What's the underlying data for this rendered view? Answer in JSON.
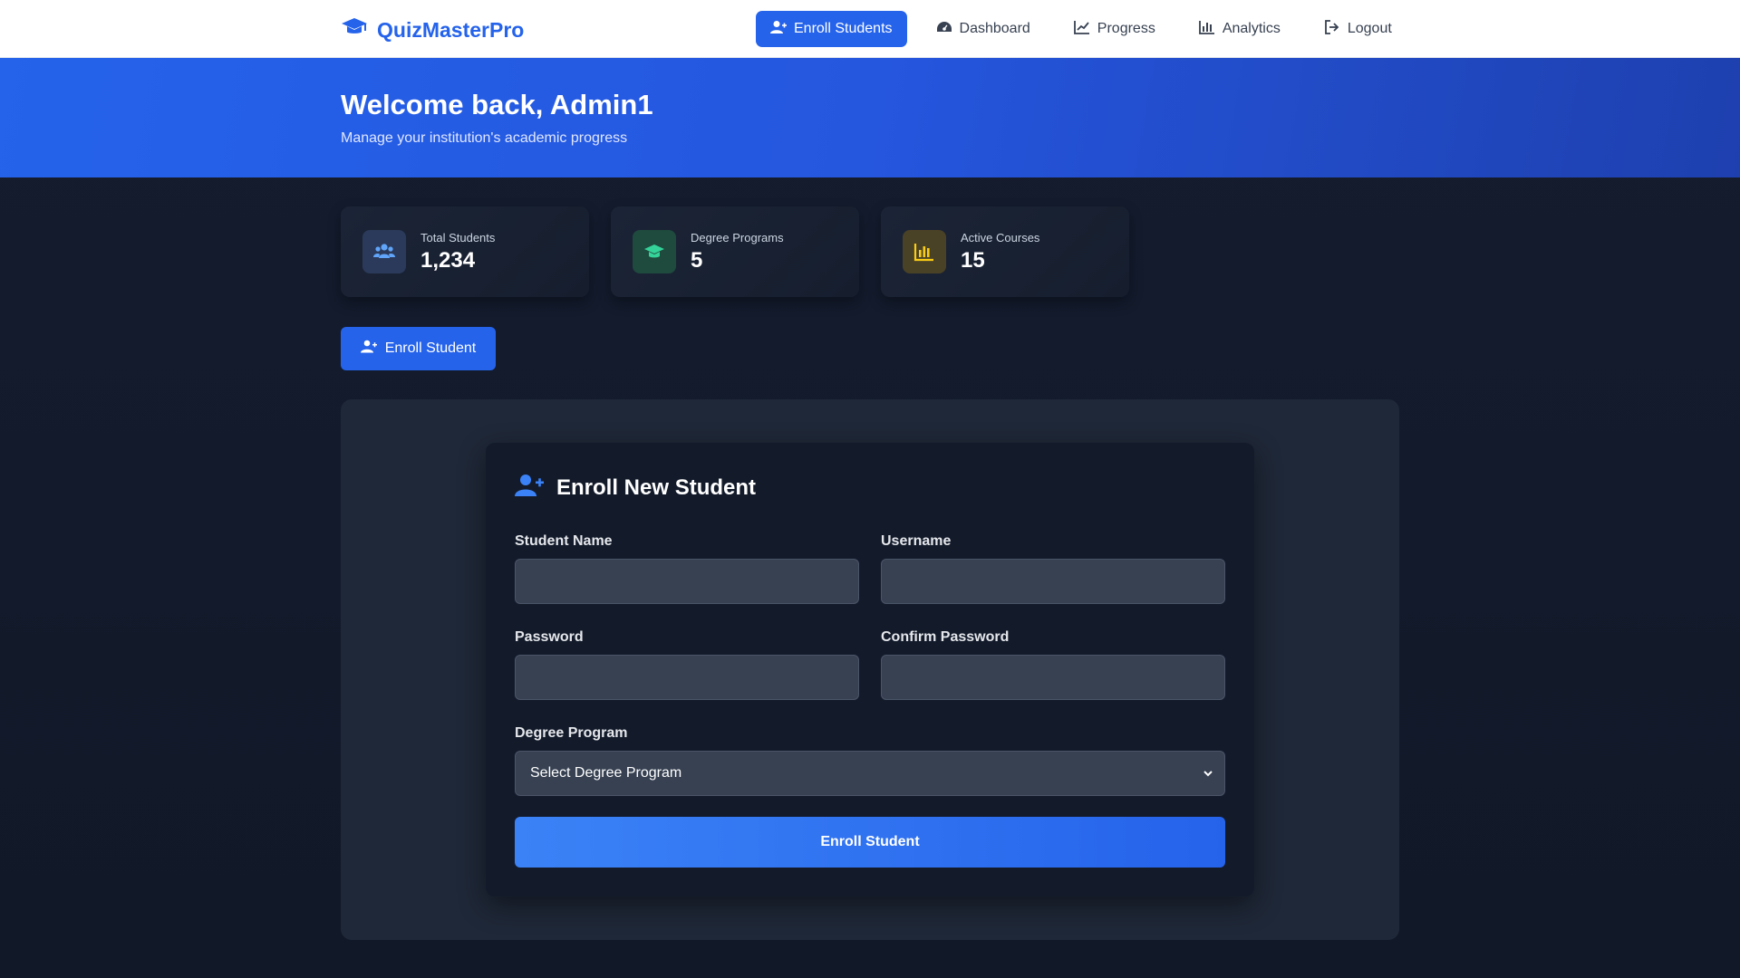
{
  "brand": {
    "name": "QuizMasterPro",
    "icon": "graduation-cap-icon",
    "color": "#2563eb"
  },
  "nav": {
    "items": [
      {
        "label": "Enroll Students",
        "icon": "user-plus-icon",
        "active": true
      },
      {
        "label": "Dashboard",
        "icon": "gauge-icon",
        "active": false
      },
      {
        "label": "Progress",
        "icon": "line-chart-icon",
        "active": false
      },
      {
        "label": "Analytics",
        "icon": "bar-chart-icon",
        "active": false
      },
      {
        "label": "Logout",
        "icon": "logout-icon",
        "active": false
      }
    ]
  },
  "hero": {
    "title": "Welcome back, Admin1",
    "subtitle": "Manage your institution's academic progress"
  },
  "stats": [
    {
      "label": "Total Students",
      "value": "1,234",
      "icon": "users-icon",
      "accent": "#60a5fa"
    },
    {
      "label": "Degree Programs",
      "value": "5",
      "icon": "graduation-cap-icon",
      "accent": "#34d399"
    },
    {
      "label": "Active Courses",
      "value": "15",
      "icon": "bar-chart-icon",
      "accent": "#facc15"
    }
  ],
  "enroll_button": {
    "label": "Enroll Student",
    "icon": "user-plus-icon"
  },
  "form": {
    "title": "Enroll New Student",
    "icon": "user-plus-icon",
    "fields": {
      "student_name": {
        "label": "Student Name",
        "value": "",
        "placeholder": ""
      },
      "username": {
        "label": "Username",
        "value": "",
        "placeholder": ""
      },
      "password": {
        "label": "Password",
        "value": "",
        "placeholder": ""
      },
      "confirm_password": {
        "label": "Confirm Password",
        "value": "",
        "placeholder": ""
      },
      "degree_program": {
        "label": "Degree Program",
        "selected": "Select Degree Program"
      }
    },
    "submit_label": "Enroll Student"
  },
  "colors": {
    "primary": "#2563eb",
    "panel": "#1f2838",
    "card": "#131b2b",
    "input": "#374152"
  }
}
